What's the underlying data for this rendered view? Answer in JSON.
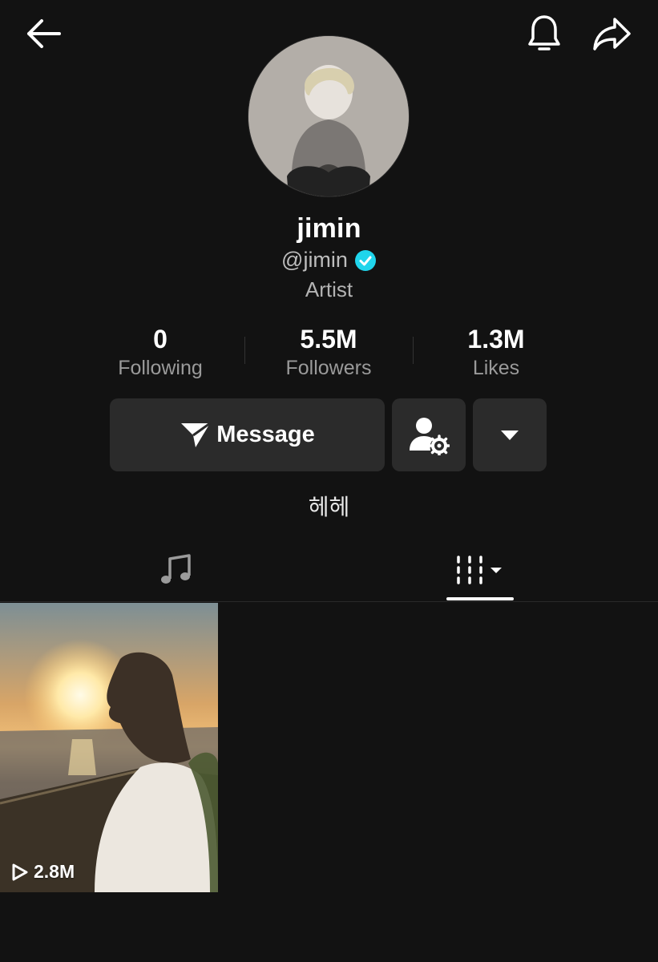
{
  "header": {
    "back_icon": "arrow-left-icon",
    "notification_icon": "bell-icon",
    "share_icon": "share-arrow-icon"
  },
  "profile": {
    "display_name": "jimin",
    "handle": "@jimin",
    "verified": true,
    "role": "Artist",
    "bio": "헤헤"
  },
  "stats": [
    {
      "value": "0",
      "label": "Following"
    },
    {
      "value": "5.5M",
      "label": "Followers"
    },
    {
      "value": "1.3M",
      "label": "Likes"
    }
  ],
  "actions": {
    "message_label": "Message",
    "message_icon": "send-icon",
    "manage_icon": "user-settings-icon",
    "more_icon": "caret-down-icon"
  },
  "tabs": [
    {
      "name": "music",
      "icon": "music-note-icon",
      "active": false
    },
    {
      "name": "videos",
      "icon": "grid-sort-icon",
      "active": true
    }
  ],
  "videos": [
    {
      "views": "2.8M"
    }
  ],
  "colors": {
    "background": "#121212",
    "button": "#2b2b2b",
    "verified": "#20d5ec",
    "secondary_text": "#9a9a9a"
  }
}
